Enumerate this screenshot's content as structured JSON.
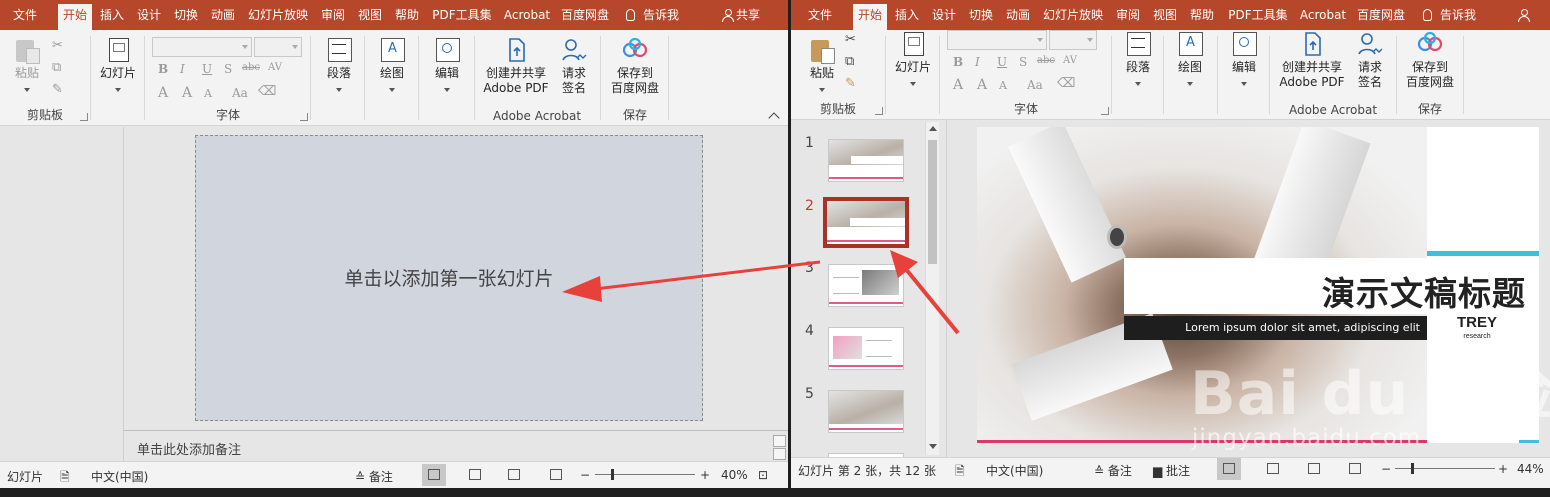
{
  "tabs_left": [
    "文件",
    "开始",
    "插入",
    "设计",
    "切换",
    "动画",
    "幻灯片放映",
    "审阅",
    "视图",
    "帮助",
    "PDF工具集",
    "Acrobat",
    "百度网盘"
  ],
  "tabs_right": [
    "文件",
    "开始",
    "插入",
    "设计",
    "切换",
    "动画",
    "幻灯片放映",
    "审阅",
    "视图",
    "帮助",
    "PDF工具集",
    "Acrobat",
    "百度网盘"
  ],
  "active_tab": "开始",
  "tell_me": "告诉我",
  "share": "共享",
  "ribbon": {
    "paste": "粘贴",
    "clipboard": "剪贴板",
    "slides": "幻灯片",
    "font": "字体",
    "paragraph": "段落",
    "drawing": "绘图",
    "editing": "编辑",
    "create_share": "创建并共享",
    "adobe_pdf": "Adobe PDF",
    "request": "请求",
    "sign": "签名",
    "adobe_acrobat": "Adobe Acrobat",
    "save_to": "保存到",
    "baidu_disk": "百度网盘",
    "save": "保存",
    "fmt_bold": "B",
    "fmt_italic": "I",
    "fmt_underline": "U",
    "fmt_shadow": "S",
    "fmt_strike": "abc",
    "fmt_spacing": "AV",
    "fmt_font_color": "A",
    "fmt_grow": "A",
    "fmt_shrink": "A",
    "fmt_case": "Aa"
  },
  "left": {
    "placeholder": "单击以添加第一张幻灯片",
    "notes": "单击此处添加备注",
    "status_slides": "幻灯片",
    "status_lang": "中文(中国)",
    "status_notes": "备注",
    "zoom": "40%"
  },
  "right": {
    "slide_numbers": [
      "1",
      "2",
      "3",
      "4",
      "5"
    ],
    "selected_slide": "2",
    "slide_title": "演示文稿标题",
    "slide_subtitle": "Lorem ipsum dolor sit amet, adipiscing elit",
    "logo_main": "TREY",
    "logo_sub": "research",
    "status_position": "幻灯片 第 2 张，共 12 张",
    "status_lang": "中文(中国)",
    "status_notes": "备注",
    "status_comments": "批注",
    "zoom": "44%"
  },
  "watermark": {
    "brand": "Bai du 经验",
    "url": "jingyan.baidu.com"
  },
  "colors": {
    "tab_bar": "#b7472a",
    "selected_thumb": "#a93226",
    "arrow": "#e8403a"
  }
}
